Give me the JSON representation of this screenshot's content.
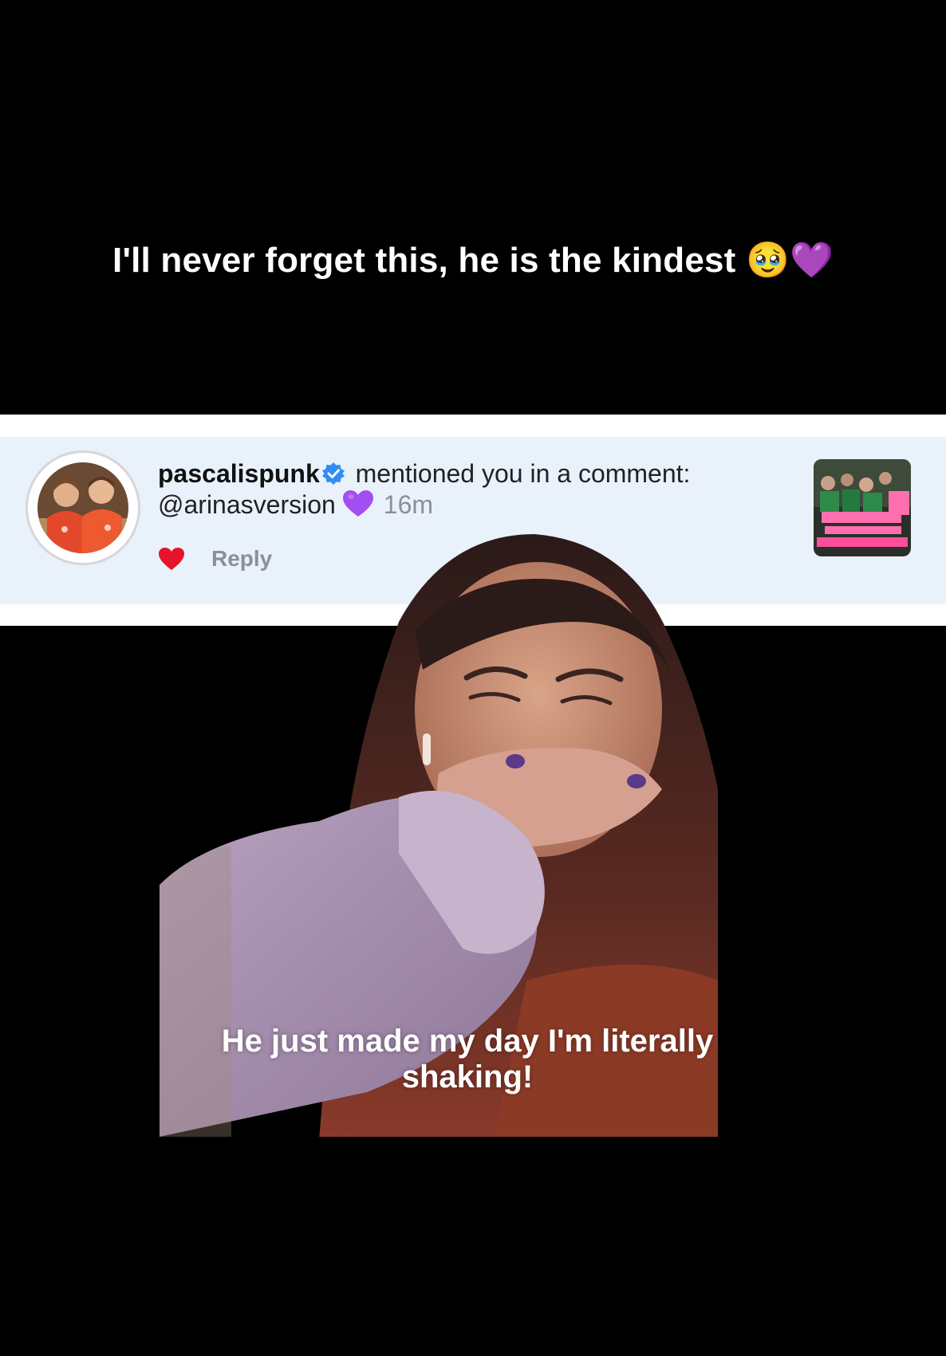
{
  "top_caption": {
    "text": "I'll never forget this, he is the kindest",
    "emojis": [
      "🥹",
      "💜"
    ]
  },
  "notification": {
    "username": "pascalispunk",
    "action_text": "mentioned you in a comment:",
    "comment_text": "@arinasversion",
    "comment_emoji": "💜",
    "time": "16m",
    "reply_label": "Reply",
    "verified_icon": "verified-badge-icon",
    "like_icon": "heart-icon",
    "accent_colors": {
      "verified": "#2f8ef4",
      "heart": "#e5142b",
      "purple_heart": "#a24ef0",
      "card_bg": "#e9f1fa"
    }
  },
  "video_caption": {
    "text": "He just made my day I'm literally shaking!"
  }
}
